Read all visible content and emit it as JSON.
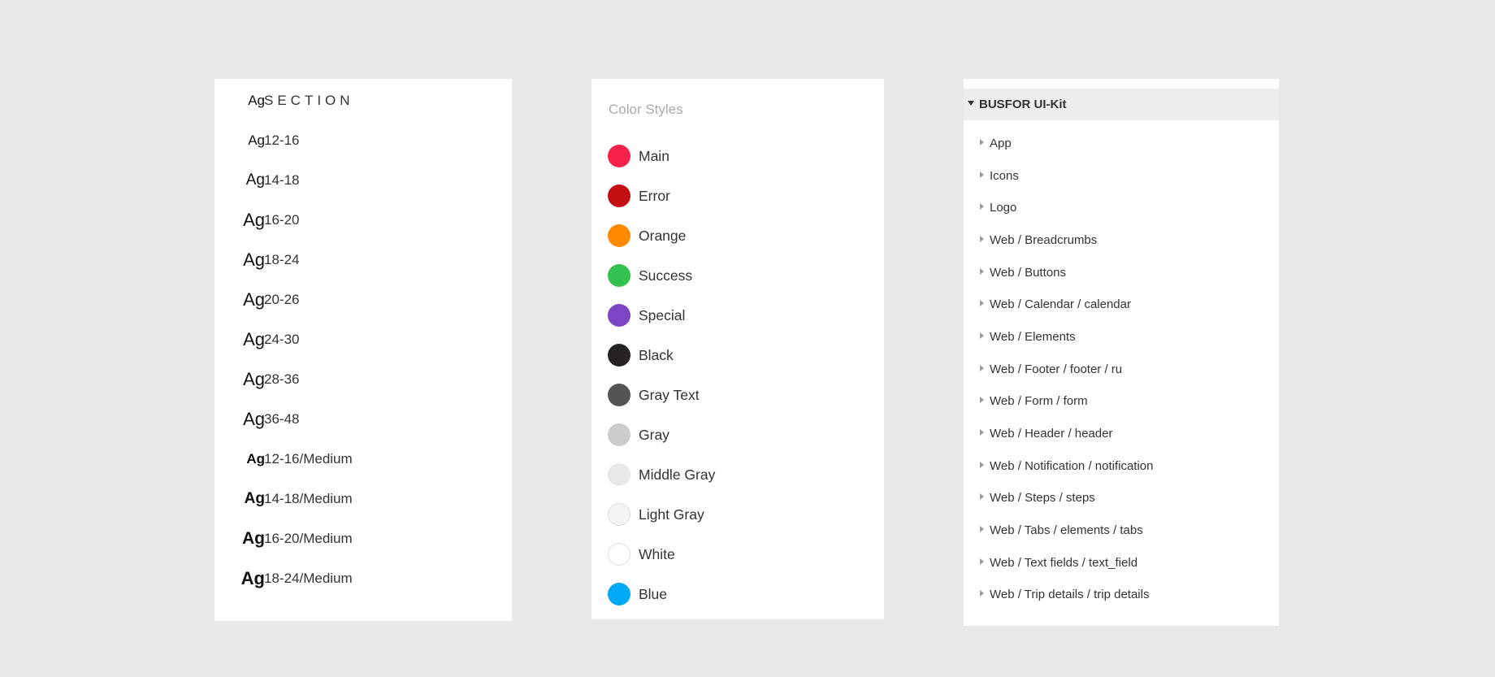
{
  "text_styles": {
    "sample_glyph": "Ag",
    "items": [
      {
        "label": "SECTION",
        "weight": "normal"
      },
      {
        "label": "12-16",
        "weight": "normal"
      },
      {
        "label": "14-18",
        "weight": "normal"
      },
      {
        "label": "16-20",
        "weight": "normal"
      },
      {
        "label": "18-24",
        "weight": "normal"
      },
      {
        "label": "20-26",
        "weight": "normal"
      },
      {
        "label": "24-30",
        "weight": "normal"
      },
      {
        "label": "28-36",
        "weight": "normal"
      },
      {
        "label": "36-48",
        "weight": "normal"
      },
      {
        "label": "12-16/Medium",
        "weight": "medium"
      },
      {
        "label": "14-18/Medium",
        "weight": "medium"
      },
      {
        "label": "16-20/Medium",
        "weight": "medium"
      },
      {
        "label": "18-24/Medium",
        "weight": "medium"
      }
    ]
  },
  "color_styles": {
    "title": "Color Styles",
    "items": [
      {
        "label": "Main",
        "color": "#f5234b"
      },
      {
        "label": "Error",
        "color": "#c40f12"
      },
      {
        "label": "Orange",
        "color": "#ff8a00"
      },
      {
        "label": "Success",
        "color": "#33c150"
      },
      {
        "label": "Special",
        "color": "#7b45c4"
      },
      {
        "label": "Black",
        "color": "#262222"
      },
      {
        "label": "Gray Text",
        "color": "#545454"
      },
      {
        "label": "Gray",
        "color": "#cccccc"
      },
      {
        "label": "Middle Gray",
        "color": "#e8e8e8"
      },
      {
        "label": "Light Gray",
        "color": "#f4f4f4"
      },
      {
        "label": "White",
        "color": "#ffffff"
      },
      {
        "label": "Blue",
        "color": "#00a8f5"
      }
    ]
  },
  "pages": {
    "title": "BUSFOR UI-Kit",
    "items": [
      {
        "label": "App"
      },
      {
        "label": "Icons"
      },
      {
        "label": "Logo"
      },
      {
        "label": "Web / Breadcrumbs"
      },
      {
        "label": "Web / Buttons"
      },
      {
        "label": "Web / Calendar / calendar"
      },
      {
        "label": "Web / Elements"
      },
      {
        "label": "Web / Footer / footer / ru"
      },
      {
        "label": "Web / Form / form"
      },
      {
        "label": "Web / Header / header"
      },
      {
        "label": "Web / Notification / notification"
      },
      {
        "label": "Web / Steps / steps"
      },
      {
        "label": "Web / Tabs / elements / tabs"
      },
      {
        "label": "Web / Text fields / text_field"
      },
      {
        "label": "Web / Trip details / trip details"
      }
    ]
  }
}
